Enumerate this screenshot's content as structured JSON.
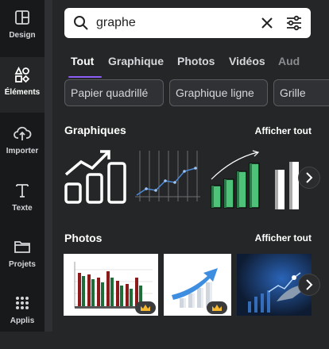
{
  "rail": {
    "items": [
      {
        "label": "Design",
        "icon": "layout-icon"
      },
      {
        "label": "Éléments",
        "icon": "shapes-icon"
      },
      {
        "label": "Importer",
        "icon": "cloud-upload-icon"
      },
      {
        "label": "Texte",
        "icon": "text-icon"
      },
      {
        "label": "Projets",
        "icon": "folder-icon"
      },
      {
        "label": "Applis",
        "icon": "apps-grid-icon"
      }
    ]
  },
  "search": {
    "value": "graphe"
  },
  "tabs": [
    "Tout",
    "Graphique",
    "Photos",
    "Vidéos",
    "Aud"
  ],
  "chips": [
    "Papier quadrillé",
    "Graphique ligne",
    "Grille"
  ],
  "sections": {
    "graphics": {
      "title": "Graphiques",
      "see_all": "Afficher tout"
    },
    "photos": {
      "title": "Photos",
      "see_all": "Afficher tout"
    }
  },
  "colors": {
    "accent": "#8b5cf6",
    "green": "#4fc27a"
  }
}
